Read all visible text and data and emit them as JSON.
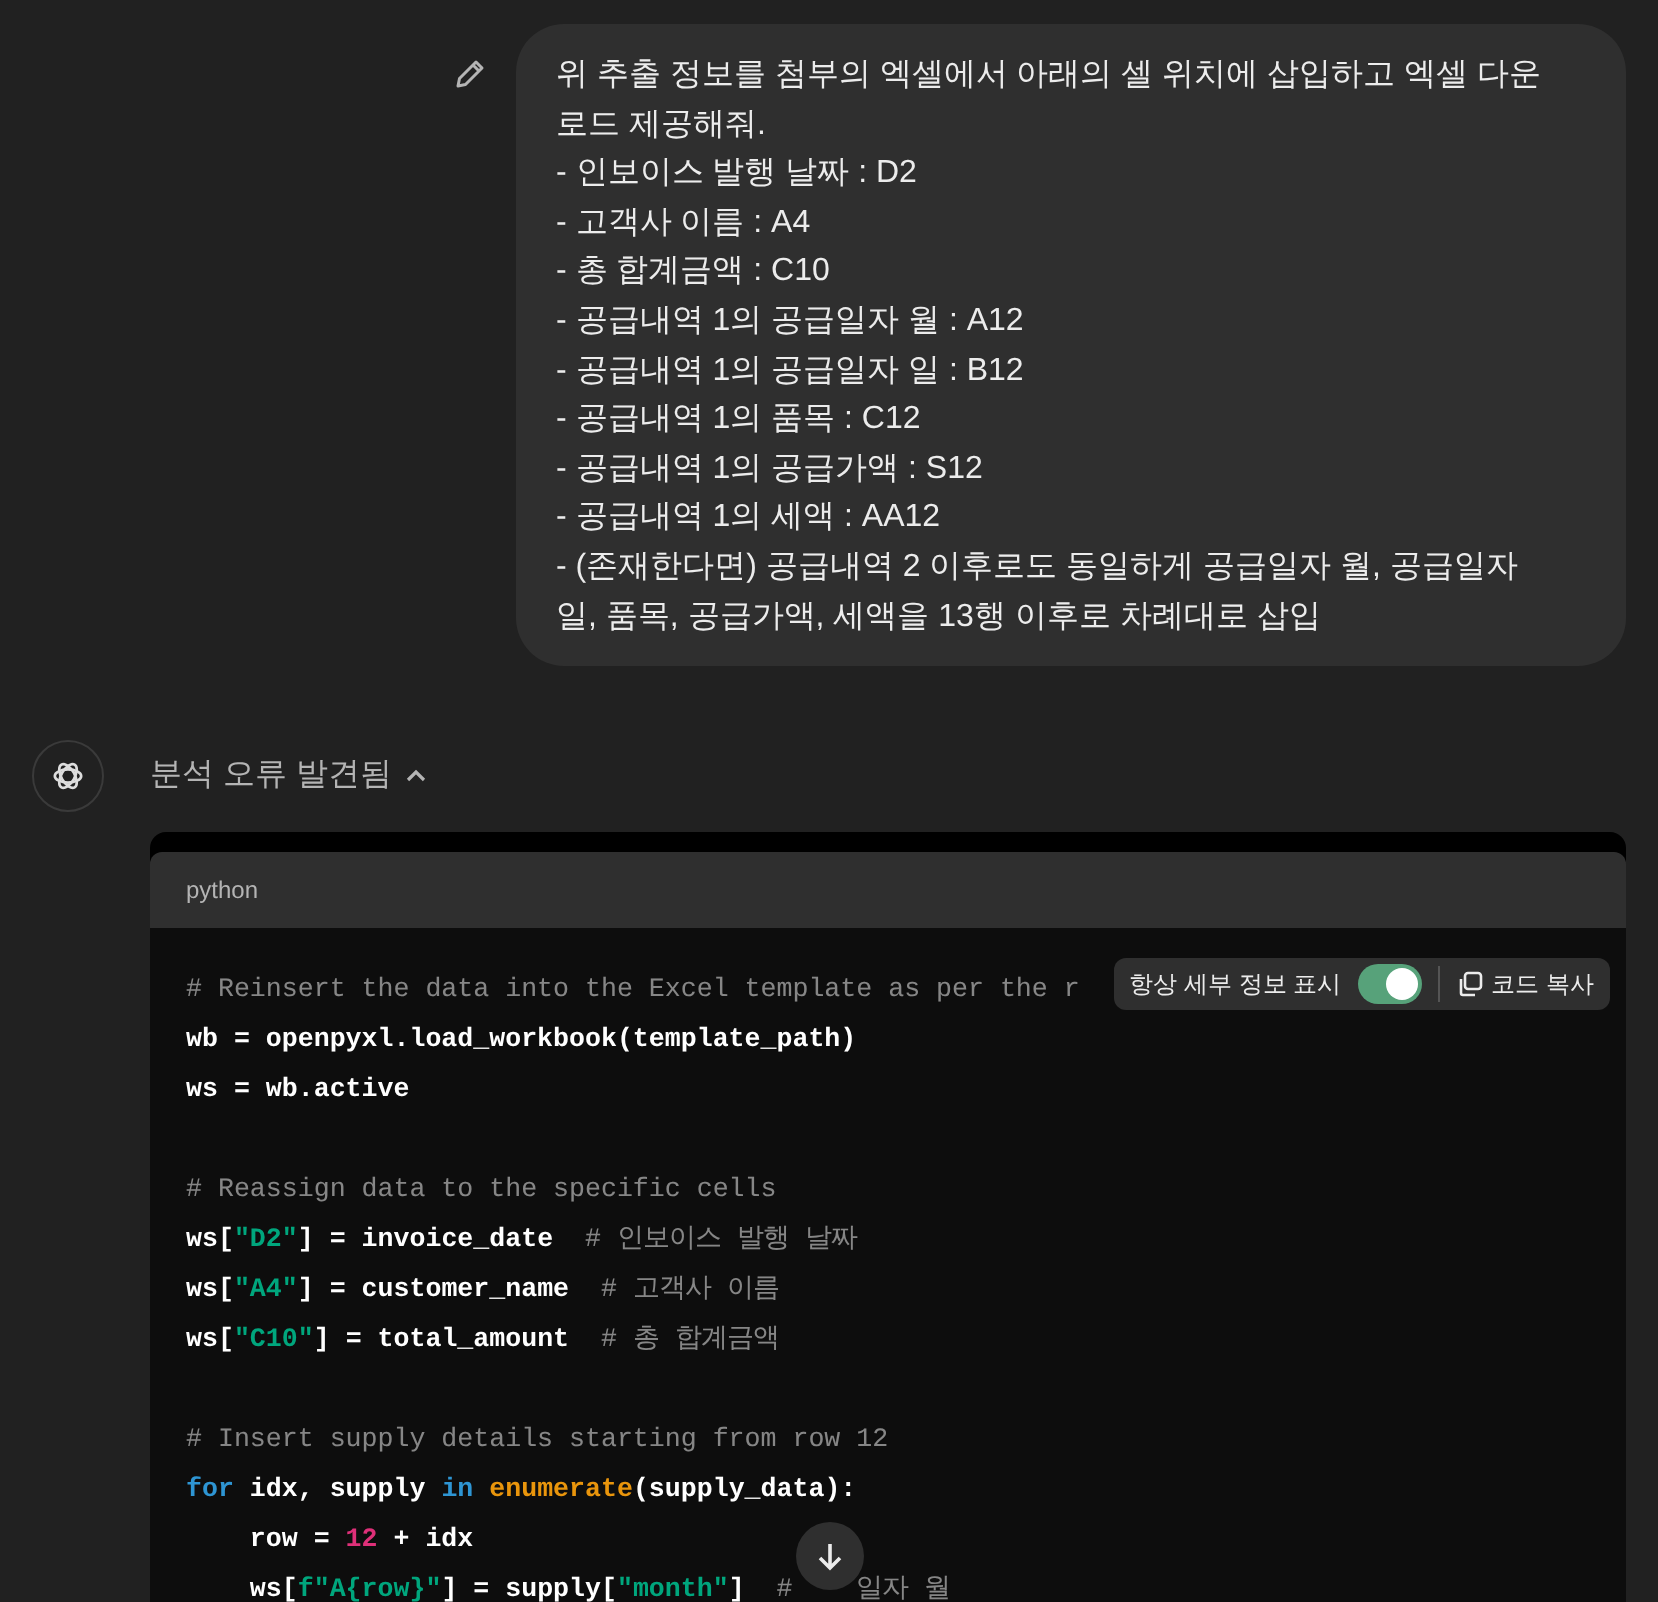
{
  "user_message": {
    "lines": [
      "위 추출 정보를 첨부의 엑셀에서 아래의 셀 위치에 삽입하고 엑셀 다운로드 제공해줘.",
      "- 인보이스 발행 날짜 : D2",
      "- 고객사 이름 : A4",
      "- 총 합계금액 : C10",
      "- 공급내역 1의 공급일자 월 : A12",
      "- 공급내역 1의 공급일자 일 : B12",
      "- 공급내역 1의 품목 : C12",
      "- 공급내역 1의 공급가액 : S12",
      "- 공급내역 1의 세액 : AA12",
      "- (존재한다면) 공급내역 2 이후로도 동일하게 공급일자 월, 공급일자 일, 품목, 공급가액, 세액을 13행 이후로 차례대로 삽입"
    ]
  },
  "assistant": {
    "status": "분석 오류 발견됨",
    "expanded": true,
    "code_block": {
      "language": "python",
      "always_show_details": {
        "label": "항상 세부 정보 표시",
        "on": true
      },
      "copy_button": "코드 복사",
      "lines": [
        {
          "tokens": [
            {
              "text": "# Reinsert the data into the Excel template as per the r",
              "kind": "comment"
            }
          ]
        },
        {
          "tokens": [
            {
              "text": "wb = openpyxl.load_workbook(template_path)",
              "kind": "plain"
            }
          ]
        },
        {
          "tokens": [
            {
              "text": "ws = wb.active",
              "kind": "plain"
            }
          ]
        },
        {
          "kind": "blank"
        },
        {
          "tokens": [
            {
              "text": "# Reassign data to the specific cells",
              "kind": "comment"
            }
          ]
        },
        {
          "tokens": [
            {
              "text": "ws[",
              "kind": "plain"
            },
            {
              "text": "\"D2\"",
              "kind": "string"
            },
            {
              "text": "] = invoice_date  ",
              "kind": "plain"
            },
            {
              "text": "# 인보이스 발행 날짜",
              "kind": "comment"
            }
          ]
        },
        {
          "tokens": [
            {
              "text": "ws[",
              "kind": "plain"
            },
            {
              "text": "\"A4\"",
              "kind": "string"
            },
            {
              "text": "] = customer_name  ",
              "kind": "plain"
            },
            {
              "text": "# 고객사 이름",
              "kind": "comment"
            }
          ]
        },
        {
          "tokens": [
            {
              "text": "ws[",
              "kind": "plain"
            },
            {
              "text": "\"C10\"",
              "kind": "string"
            },
            {
              "text": "] = total_amount  ",
              "kind": "plain"
            },
            {
              "text": "# 총 합계금액",
              "kind": "comment"
            }
          ]
        },
        {
          "kind": "blank"
        },
        {
          "tokens": [
            {
              "text": "# Insert supply details starting from row 12",
              "kind": "comment"
            }
          ]
        },
        {
          "tokens": [
            {
              "text": "for",
              "kind": "keyword"
            },
            {
              "text": " idx, supply ",
              "kind": "plain"
            },
            {
              "text": "in",
              "kind": "keyword"
            },
            {
              "text": " enumerate",
              "kind": "builtin"
            },
            {
              "text": "(supply_data):",
              "kind": "plain"
            }
          ]
        },
        {
          "tokens": [
            {
              "text": "    row = ",
              "kind": "plain"
            },
            {
              "text": "12",
              "kind": "number"
            },
            {
              "text": " + idx",
              "kind": "plain"
            }
          ]
        },
        {
          "tokens": [
            {
              "text": "    ws[",
              "kind": "plain"
            },
            {
              "text": "f\"A{row}\"",
              "kind": "string"
            },
            {
              "text": "] = supply[",
              "kind": "plain"
            },
            {
              "text": "\"month\"",
              "kind": "string"
            },
            {
              "text": "]  ",
              "kind": "plain"
            },
            {
              "text": "#",
              "kind": "comment"
            },
            {
              "kind": "covered"
            },
            {
              "text": "일자 월",
              "kind": "comment"
            }
          ]
        }
      ]
    }
  }
}
